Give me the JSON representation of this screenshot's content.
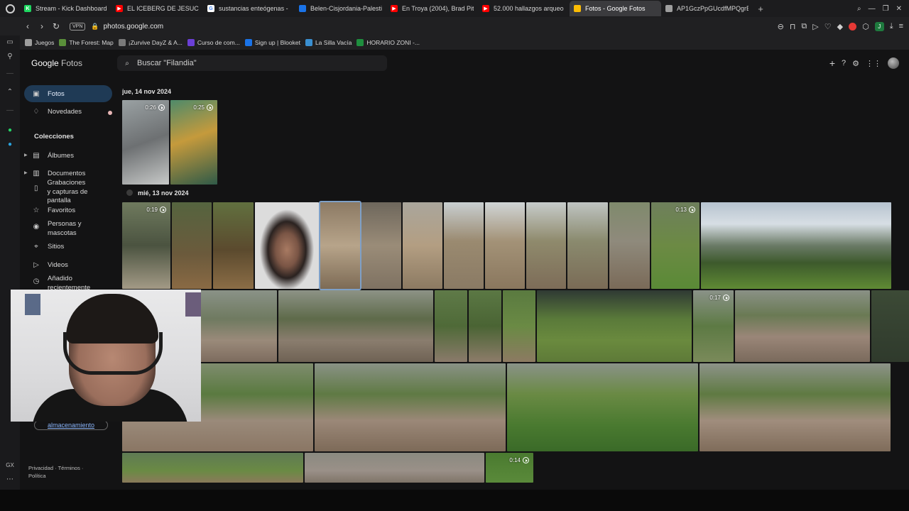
{
  "browser": {
    "tabs": [
      {
        "label": "Stream - Kick Dashboard",
        "fav_color": "#1ed760",
        "fav_text": "K",
        "active": false
      },
      {
        "label": "EL ICEBERG DE JESUCRI",
        "fav_color": "#ff0000",
        "fav_text": "▶",
        "active": false
      },
      {
        "label": "sustancias enteógenas -",
        "fav_color": "#ffffff",
        "fav_text": "G",
        "active": false
      },
      {
        "label": "Belen-Cisjordania-Palesti",
        "fav_color": "#1a73e8",
        "fav_text": "",
        "active": false
      },
      {
        "label": "En Troya (2004), Brad Pit",
        "fav_color": "#ff0000",
        "fav_text": "▶",
        "active": false
      },
      {
        "label": "52.000 hallazgos arqueo",
        "fav_color": "#ff0000",
        "fav_text": "▶",
        "active": false
      },
      {
        "label": "Fotos - Google Fotos",
        "fav_color": "#fbbc04",
        "fav_text": "",
        "active": true
      },
      {
        "label": "AP1GczPpGUcdfMPQgrEF",
        "fav_color": "#9e9e9e",
        "fav_text": "",
        "active": false
      }
    ],
    "new_tab": "+",
    "vpn_label": "VPN",
    "url": "photos.google.com",
    "bookmarks": [
      {
        "label": "Juegos",
        "color": "#9e9e9e"
      },
      {
        "label": "The Forest: Map",
        "color": "#5a8f3a"
      },
      {
        "label": "¡Zurvive DayZ & A...",
        "color": "#7a7a7a"
      },
      {
        "label": "Curso de com...",
        "color": "#6b3fd6"
      },
      {
        "label": "Sign up | Blooket",
        "color": "#1a73e8"
      },
      {
        "label": "La Silla Vacía",
        "color": "#3a8fd1"
      },
      {
        "label": "HORARIO ZONI -...",
        "color": "#1e8e3e"
      }
    ]
  },
  "app": {
    "logo_brand": "Google",
    "logo_product": "Fotos",
    "search_placeholder": "Buscar \"Filandia\"",
    "nav": [
      {
        "label": "Fotos",
        "icon": "photo-icon",
        "glyph": "▣",
        "active": true
      },
      {
        "label": "Novedades",
        "icon": "bell-icon",
        "glyph": "🔔",
        "active": false
      }
    ],
    "collections_title": "Colecciones",
    "collections": [
      {
        "label": "Álbumes",
        "icon": "album-icon",
        "glyph": "▤"
      },
      {
        "label": "Documentos",
        "icon": "document-icon",
        "glyph": "▥"
      },
      {
        "label": "Grabaciones y capturas de pantalla",
        "icon": "phone-icon",
        "glyph": "▯"
      },
      {
        "label": "Favoritos",
        "icon": "star-icon",
        "glyph": "☆"
      },
      {
        "label": "Personas y mascotas",
        "icon": "face-icon",
        "glyph": "◉"
      },
      {
        "label": "Sitios",
        "icon": "place-icon",
        "glyph": "⌖"
      },
      {
        "label": "Videos",
        "icon": "video-icon",
        "glyph": "▷"
      },
      {
        "label": "Añadido recientemente",
        "icon": "recent-icon",
        "glyph": "◷"
      }
    ],
    "storage_link": "almacenamiento",
    "footer": {
      "privacy": "Privacidad",
      "terms": "Términos",
      "policy": "Política"
    },
    "groups": [
      {
        "date": "jue, 14 nov 2024"
      },
      {
        "date": "mié, 13 nov 2024"
      }
    ],
    "durations": {
      "v1": "0:26",
      "v2": "0:25",
      "v3": "0:19",
      "v4": "0:13",
      "v5": "0:17",
      "v6": "0:14"
    }
  },
  "colors": {
    "accent": "#8ab4f8",
    "active_nav_bg": "#1f3a55",
    "app_bg": "#131314"
  }
}
